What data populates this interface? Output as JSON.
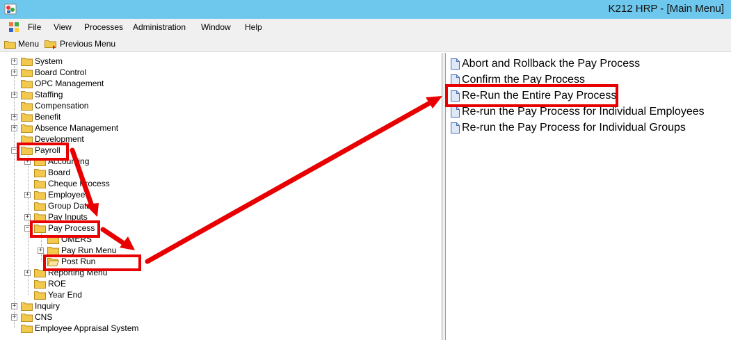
{
  "window": {
    "title": "K212 HRP - [Main Menu]"
  },
  "menubar": {
    "items": [
      "File",
      "View",
      "Processes",
      "Administration",
      "Window",
      "Help"
    ]
  },
  "toolbar": {
    "menu_label": "Menu",
    "previous_menu_label": "Previous Menu"
  },
  "tree": {
    "items": [
      {
        "label": "System"
      },
      {
        "label": "Board Control"
      },
      {
        "label": "OPC Management"
      },
      {
        "label": "Staffing"
      },
      {
        "label": "Compensation"
      },
      {
        "label": "Benefit"
      },
      {
        "label": "Absence Management"
      },
      {
        "label": "Development"
      },
      {
        "label": "Payroll"
      },
      {
        "label": "Accounting"
      },
      {
        "label": "Board"
      },
      {
        "label": "Cheque Process"
      },
      {
        "label": "Employee"
      },
      {
        "label": "Group Data"
      },
      {
        "label": "Pay Inputs"
      },
      {
        "label": "Pay Process"
      },
      {
        "label": "OMERS"
      },
      {
        "label": "Pay Run Menu"
      },
      {
        "label": "Post Run"
      },
      {
        "label": "Reporting Menu"
      },
      {
        "label": "ROE"
      },
      {
        "label": "Year End"
      },
      {
        "label": "Inquiry"
      },
      {
        "label": "CNS"
      },
      {
        "label": "Employee Appraisal System"
      }
    ]
  },
  "list": {
    "items": [
      {
        "label": "Abort and Rollback the Pay Process"
      },
      {
        "label": "Confirm the Pay Process"
      },
      {
        "label": "Re-Run the Entire Pay Process"
      },
      {
        "label": "Re-run the Pay Process for Individual Employees"
      },
      {
        "label": "Re-run the Pay Process for Individual Groups"
      }
    ]
  },
  "colors": {
    "titlebar": "#6ec7ec",
    "annotation": "#e80000",
    "folder": "#f2c94c"
  }
}
